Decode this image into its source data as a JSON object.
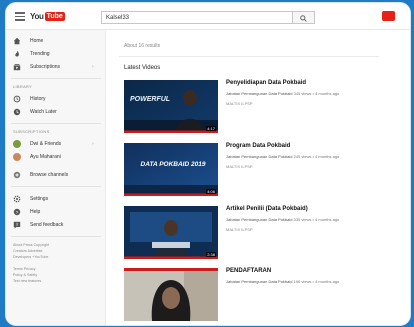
{
  "header": {
    "logo_you": "You",
    "logo_tube": "Tube",
    "search_value": "Kalsel33"
  },
  "sidebar": {
    "top_items": [
      {
        "label": "Home",
        "icon": "home-icon"
      },
      {
        "label": "Trending",
        "icon": "trending-icon"
      },
      {
        "label": "Subscriptions",
        "icon": "subscriptions-icon"
      }
    ],
    "library_heading": "LIBRARY",
    "library_items": [
      {
        "label": "History",
        "icon": "history-icon"
      },
      {
        "label": "Watch Later",
        "icon": "watch-later-icon"
      }
    ],
    "subscriptions_heading": "SUBSCRIPTIONS",
    "subscription_items": [
      {
        "label": "Dwi & Friends",
        "avatar_color": "#7a9c3c"
      },
      {
        "label": "Ayu Maharani",
        "avatar_color": "#c98a5b"
      }
    ],
    "browse_channels": "Browse channels",
    "bottom_items": [
      {
        "label": "Settings",
        "icon": "settings-icon"
      },
      {
        "label": "Help",
        "icon": "help-icon"
      },
      {
        "label": "Send feedback",
        "icon": "feedback-icon"
      }
    ],
    "footer_lines": [
      "About  Press  Copyright",
      "Creators  Advertise",
      "Developers  +YouTube",
      "",
      "Terms  Privacy",
      "Policy & Safety",
      "Test new features"
    ]
  },
  "main": {
    "about": "About 16 results",
    "section_title": "Latest Videos",
    "videos": [
      {
        "title": "Penyelidiapan Data Pokbaid",
        "channel": "Jabatan Pembangunan Data Pokbaid",
        "views_time": "345 views • 4 months ago",
        "desc": "MALTIX ILPSP",
        "duration": "4:17",
        "thumb_text": "POWERFUL"
      },
      {
        "title": "Program Data Pokbaid",
        "channel": "Jabatan Pembangunan Data Pokbaid",
        "views_time": "245 views • 4 months ago",
        "desc": "MALTIX ILPSP",
        "duration": "4:06",
        "thumb_text": "DATA POKBAID 2019"
      },
      {
        "title": "Artikel Penilii (Data Pokbaid)",
        "channel": "Jabatan Pembangunan Data Pokbaid",
        "views_time": "335 views • 4 months ago",
        "desc": "MALTIX ILPSP",
        "duration": "2:38",
        "thumb_text": ""
      },
      {
        "title": "PENDAFTARAN",
        "channel": "Jabatan Pembangunan Data Pokbaid",
        "views_time": "196 views • 4 months ago",
        "desc": "",
        "duration": "",
        "thumb_text": ""
      }
    ]
  },
  "colors": {
    "background_blue": "#1f7bc4",
    "youtube_red": "#e62117",
    "progress_red": "#cc1b1b"
  }
}
